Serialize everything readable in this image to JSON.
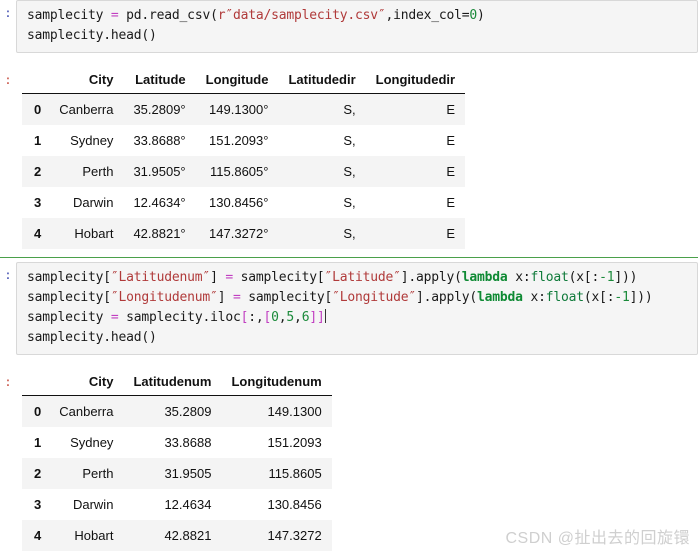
{
  "prompts": {
    "input_marker": ":",
    "output_marker": ":"
  },
  "cells": [
    {
      "type": "code",
      "lines": [
        {
          "tokens": [
            {
              "t": "samplecity ",
              "c": "plain"
            },
            {
              "t": "=",
              "c": "op"
            },
            {
              "t": " pd.read_csv(",
              "c": "plain"
            },
            {
              "t": "r″data/samplecity.csv″",
              "c": "str"
            },
            {
              "t": ",index_col=",
              "c": "plain"
            },
            {
              "t": "0",
              "c": "num"
            },
            {
              "t": ")",
              "c": "plain"
            }
          ]
        },
        {
          "tokens": [
            {
              "t": "samplecity.head()",
              "c": "plain"
            }
          ]
        }
      ]
    },
    {
      "type": "output-table",
      "index_header": "",
      "columns": [
        "City",
        "Latitude",
        "Longitude",
        "Latitudedir",
        "Longitudedir"
      ],
      "rows": [
        {
          "index": "0",
          "cells": [
            "Canberra",
            "35.2809°",
            "149.1300°",
            "S,",
            "E"
          ]
        },
        {
          "index": "1",
          "cells": [
            "Sydney",
            "33.8688°",
            "151.2093°",
            "S,",
            "E"
          ]
        },
        {
          "index": "2",
          "cells": [
            "Perth",
            "31.9505°",
            "115.8605°",
            "S,",
            "E"
          ]
        },
        {
          "index": "3",
          "cells": [
            "Darwin",
            "12.4634°",
            "130.8456°",
            "S,",
            "E"
          ]
        },
        {
          "index": "4",
          "cells": [
            "Hobart",
            "42.8821°",
            "147.3272°",
            "S,",
            "E"
          ]
        }
      ]
    },
    {
      "type": "code",
      "lines": [
        {
          "tokens": [
            {
              "t": "samplecity[",
              "c": "plain"
            },
            {
              "t": "″Latitudenum″",
              "c": "str"
            },
            {
              "t": "] ",
              "c": "plain"
            },
            {
              "t": "=",
              "c": "op"
            },
            {
              "t": " samplecity[",
              "c": "plain"
            },
            {
              "t": "″Latitude″",
              "c": "str"
            },
            {
              "t": "].apply(",
              "c": "plain"
            },
            {
              "t": "lambda",
              "c": "kw"
            },
            {
              "t": " x:",
              "c": "plain"
            },
            {
              "t": "float",
              "c": "bi"
            },
            {
              "t": "(x[:",
              "c": "plain"
            },
            {
              "t": "-1",
              "c": "num"
            },
            {
              "t": "]))",
              "c": "plain"
            }
          ]
        },
        {
          "tokens": [
            {
              "t": "samplecity[",
              "c": "plain"
            },
            {
              "t": "″Longitudenum″",
              "c": "str"
            },
            {
              "t": "] ",
              "c": "plain"
            },
            {
              "t": "=",
              "c": "op"
            },
            {
              "t": " samplecity[",
              "c": "plain"
            },
            {
              "t": "″Longitude″",
              "c": "str"
            },
            {
              "t": "].apply(",
              "c": "plain"
            },
            {
              "t": "lambda",
              "c": "kw"
            },
            {
              "t": " x:",
              "c": "plain"
            },
            {
              "t": "float",
              "c": "bi"
            },
            {
              "t": "(x[:",
              "c": "plain"
            },
            {
              "t": "-1",
              "c": "num"
            },
            {
              "t": "]))",
              "c": "plain"
            }
          ]
        },
        {
          "tokens": [
            {
              "t": "samplecity ",
              "c": "plain"
            },
            {
              "t": "=",
              "c": "op"
            },
            {
              "t": " samplecity.iloc",
              "c": "plain"
            },
            {
              "t": "[",
              "c": "brk"
            },
            {
              "t": ":,",
              "c": "plain"
            },
            {
              "t": "[",
              "c": "brk"
            },
            {
              "t": "0",
              "c": "num"
            },
            {
              "t": ",",
              "c": "plain"
            },
            {
              "t": "5",
              "c": "num"
            },
            {
              "t": ",",
              "c": "plain"
            },
            {
              "t": "6",
              "c": "num"
            },
            {
              "t": "]]",
              "c": "brk"
            }
          ],
          "caret": true
        },
        {
          "tokens": [
            {
              "t": "samplecity.head()",
              "c": "plain"
            }
          ]
        }
      ]
    },
    {
      "type": "output-table",
      "index_header": "",
      "columns": [
        "City",
        "Latitudenum",
        "Longitudenum"
      ],
      "rows": [
        {
          "index": "0",
          "cells": [
            "Canberra",
            "35.2809",
            "149.1300"
          ]
        },
        {
          "index": "1",
          "cells": [
            "Sydney",
            "33.8688",
            "151.2093"
          ]
        },
        {
          "index": "2",
          "cells": [
            "Perth",
            "31.9505",
            "115.8605"
          ]
        },
        {
          "index": "3",
          "cells": [
            "Darwin",
            "12.4634",
            "130.8456"
          ]
        },
        {
          "index": "4",
          "cells": [
            "Hobart",
            "42.8821",
            "147.3272"
          ]
        }
      ]
    }
  ],
  "watermark": {
    "text": "CSDN @扯出去的回旋镮"
  },
  "colors": {
    "string": "#b03a3a",
    "operator": "#c13fc1",
    "number": "#1a8a3a",
    "keyword": "#0f8a34",
    "separator_green": "#4aa04a",
    "cell_bg": "#f5f5f5",
    "row_alt_bg": "#f4f4f4"
  }
}
